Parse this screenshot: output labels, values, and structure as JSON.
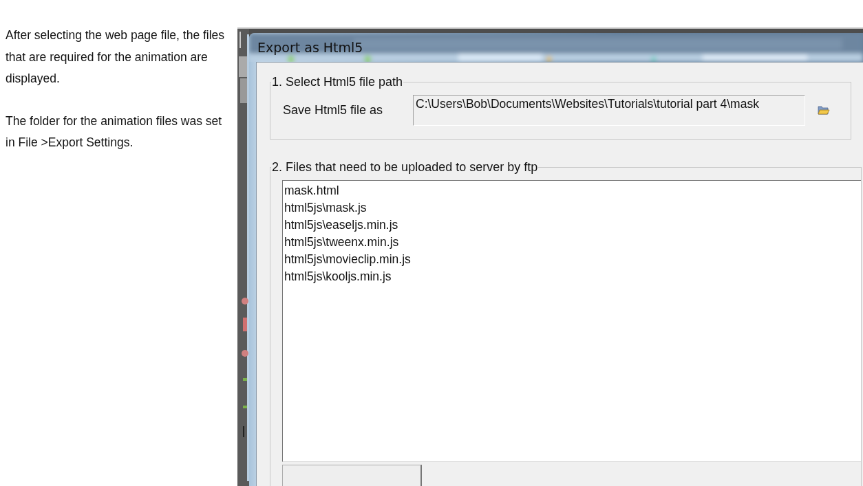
{
  "instructions": [
    "After selecting the web page file, the files that are required for the animation are displayed.",
    "The folder for the animation files was set in File >Export Settings."
  ],
  "dialog": {
    "title": "Export as Html5",
    "path_group": {
      "legend": "1. Select Html5 file path",
      "label": "Save Html5 file as",
      "value": "C:\\Users\\Bob\\Documents\\Websites\\Tutorials\\tutorial part 4\\mask"
    },
    "files_group": {
      "legend": "2. Files that need to be uploaded to server by ftp",
      "files": [
        "mask.html",
        "html5js\\mask.js",
        "html5js\\easeljs.min.js",
        "html5js\\tweenx.min.js",
        "html5js\\movieclip.min.js",
        "html5js\\kooljs.min.js"
      ]
    }
  }
}
